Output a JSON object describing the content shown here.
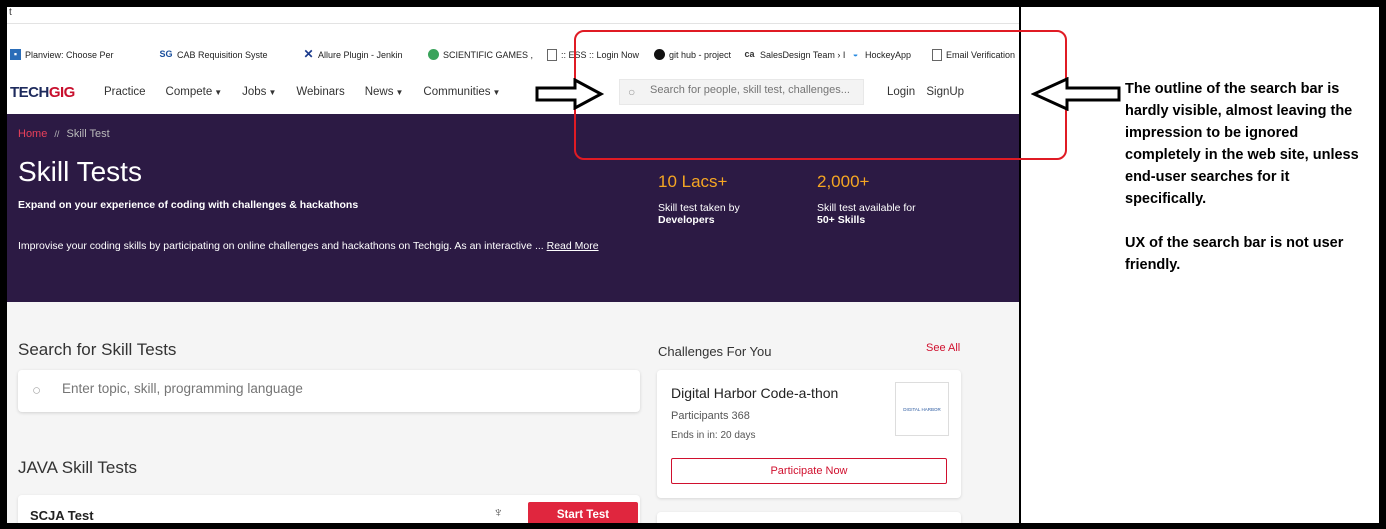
{
  "browser": {
    "address_fragment": "t",
    "bookmarks": [
      {
        "icon": "planview-icon",
        "label": "Planview: Choose Per"
      },
      {
        "icon": "sg-icon",
        "label": "CAB Requisition Syste"
      },
      {
        "icon": "allure-icon",
        "label": "Allure Plugin - Jenkin"
      },
      {
        "icon": "scientific-games-icon",
        "label": "SCIENTIFIC GAMES ,"
      },
      {
        "icon": "page-icon",
        "label": ":: ESS :: Login Now"
      },
      {
        "icon": "github-icon",
        "label": "git hub - project"
      },
      {
        "icon": "ca-icon",
        "label": "SalesDesign Team › I"
      },
      {
        "icon": "hockeyapp-icon",
        "label": "HockeyApp"
      },
      {
        "icon": "page-icon",
        "label": "Email Verification"
      }
    ]
  },
  "nav": {
    "logo_a": "TECH",
    "logo_b": "GIG",
    "links": [
      "Practice",
      "Compete",
      "Jobs",
      "Webinars",
      "News",
      "Communities"
    ],
    "search_placeholder": "Search for people, skill test, challenges...",
    "login": "Login",
    "signup": "SignUp"
  },
  "hero": {
    "breadcrumb_home": "Home",
    "breadcrumb_sep": "//",
    "breadcrumb_current": "Skill Test",
    "title": "Skill Tests",
    "subtitle": "Expand on your experience of coding with challenges & hackathons",
    "description": "Improvise your coding skills by participating on online challenges and hackathons on Techgig. As an interactive ...",
    "read_more": "Read More",
    "stats": [
      {
        "number": "10 Lacs+",
        "line1": "Skill test taken by",
        "line2": "Developers"
      },
      {
        "number": "2,000+",
        "line1": "Skill test available for",
        "line2": "50+ Skills"
      }
    ]
  },
  "main": {
    "search_title": "Search for Skill Tests",
    "search_placeholder": "Enter topic, skill, programming language",
    "java_title": "JAVA Skill Tests",
    "test_name": "SCJA Test",
    "start_test": "Start Test"
  },
  "challenges": {
    "title": "Challenges For You",
    "see_all": "See All",
    "card_title": "Digital Harbor Code-a-thon",
    "participants": "Participants 368",
    "ends": "Ends in in: 20 days",
    "logo_text": "DIGITAL HARBOR",
    "participate": "Participate Now"
  },
  "annotation": {
    "para1": "The outline of the search bar is hardly visible, almost leaving the impression to be ignored completely in the web site, unless end-user searches for it specifically.",
    "para2": "UX of the search bar is not user friendly."
  },
  "colors": {
    "hero_bg": "#2c1a44",
    "accent_red": "#e0263e",
    "stat_orange": "#f5a623",
    "annotation_red": "#e01b24"
  }
}
